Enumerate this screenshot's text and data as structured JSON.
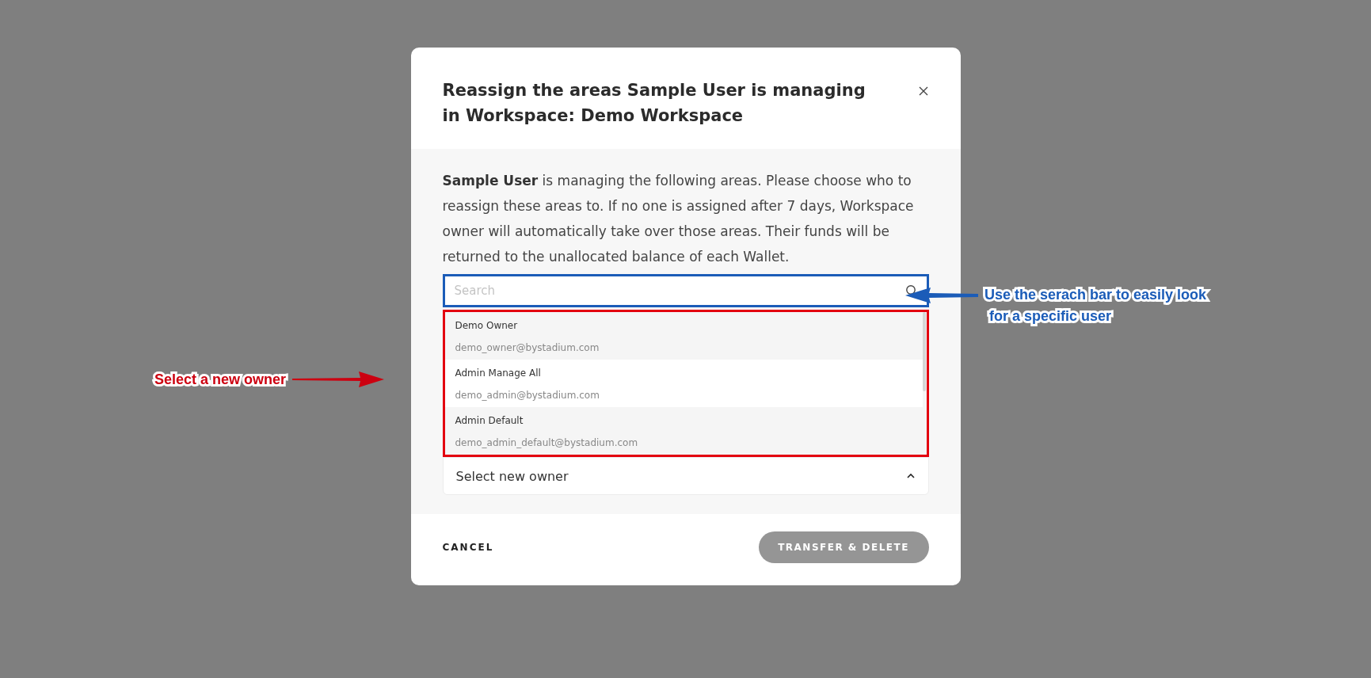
{
  "dialog": {
    "title": "Reassign the areas Sample User is managing in Workspace: Demo Workspace",
    "message": "**Sample User** is managing the following areas. Please choose who to reassign these areas to. If no one is assigned after 7 days, Workspace owner will automatically take over those areas. Their funds will be returned to the unallocated balance of each Wallet.",
    "search": {
      "placeholder": "Search"
    },
    "options": [
      {
        "name": "Demo Owner",
        "email": "demo_owner@bystadium.com"
      },
      {
        "name": "Admin Manage All",
        "email": "demo_admin@bystadium.com"
      },
      {
        "name": "Admin Default",
        "email": "demo_admin_default@bystadium.com"
      }
    ],
    "select": {
      "placeholder": "Select new owner",
      "expanded": true
    },
    "buttons": [
      {
        "label": "CANCEL",
        "kind": "text"
      },
      {
        "label": "TRANSFER & DELETE",
        "kind": "primary",
        "disabled": true
      }
    ]
  },
  "annotations": [
    {
      "lines": [
        "Select a new owner"
      ],
      "color": "#cc0010"
    },
    {
      "lines": [
        "Use the serach bar to easily look",
        "for a specific user"
      ],
      "color": "#1b5cb8"
    }
  ]
}
